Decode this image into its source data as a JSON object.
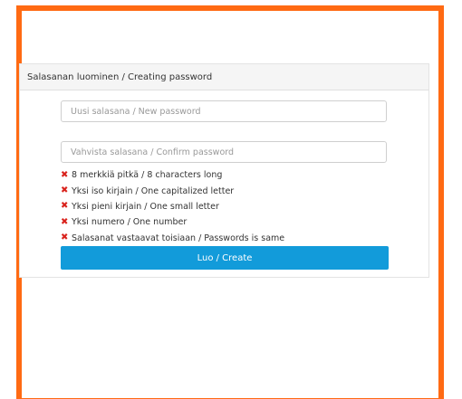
{
  "panel": {
    "title": "Salasanan luominen / Creating password"
  },
  "form": {
    "new_password_placeholder": "Uusi salasana / New password",
    "confirm_password_placeholder": "Vahvista salasana / Confirm password",
    "create_label": "Luo / Create"
  },
  "rules": [
    {
      "text": "8 merkkiä pitkä / 8 characters long",
      "status": "unmet",
      "icon": "x-icon"
    },
    {
      "text": "Yksi iso kirjain / One capitalized letter",
      "status": "unmet",
      "icon": "x-icon"
    },
    {
      "text": "Yksi pieni kirjain / One small letter",
      "status": "unmet",
      "icon": "x-icon"
    },
    {
      "text": "Yksi numero / One number",
      "status": "unmet",
      "icon": "x-icon"
    },
    {
      "text": "Salasanat vastaavat toisiaan / Passwords is same",
      "status": "unmet",
      "icon": "x-icon"
    }
  ],
  "colors": {
    "frame_border": "#ff6a13",
    "button_bg": "#129bda",
    "unmet_icon": "#d9221c",
    "header_bg": "#f5f5f5"
  }
}
